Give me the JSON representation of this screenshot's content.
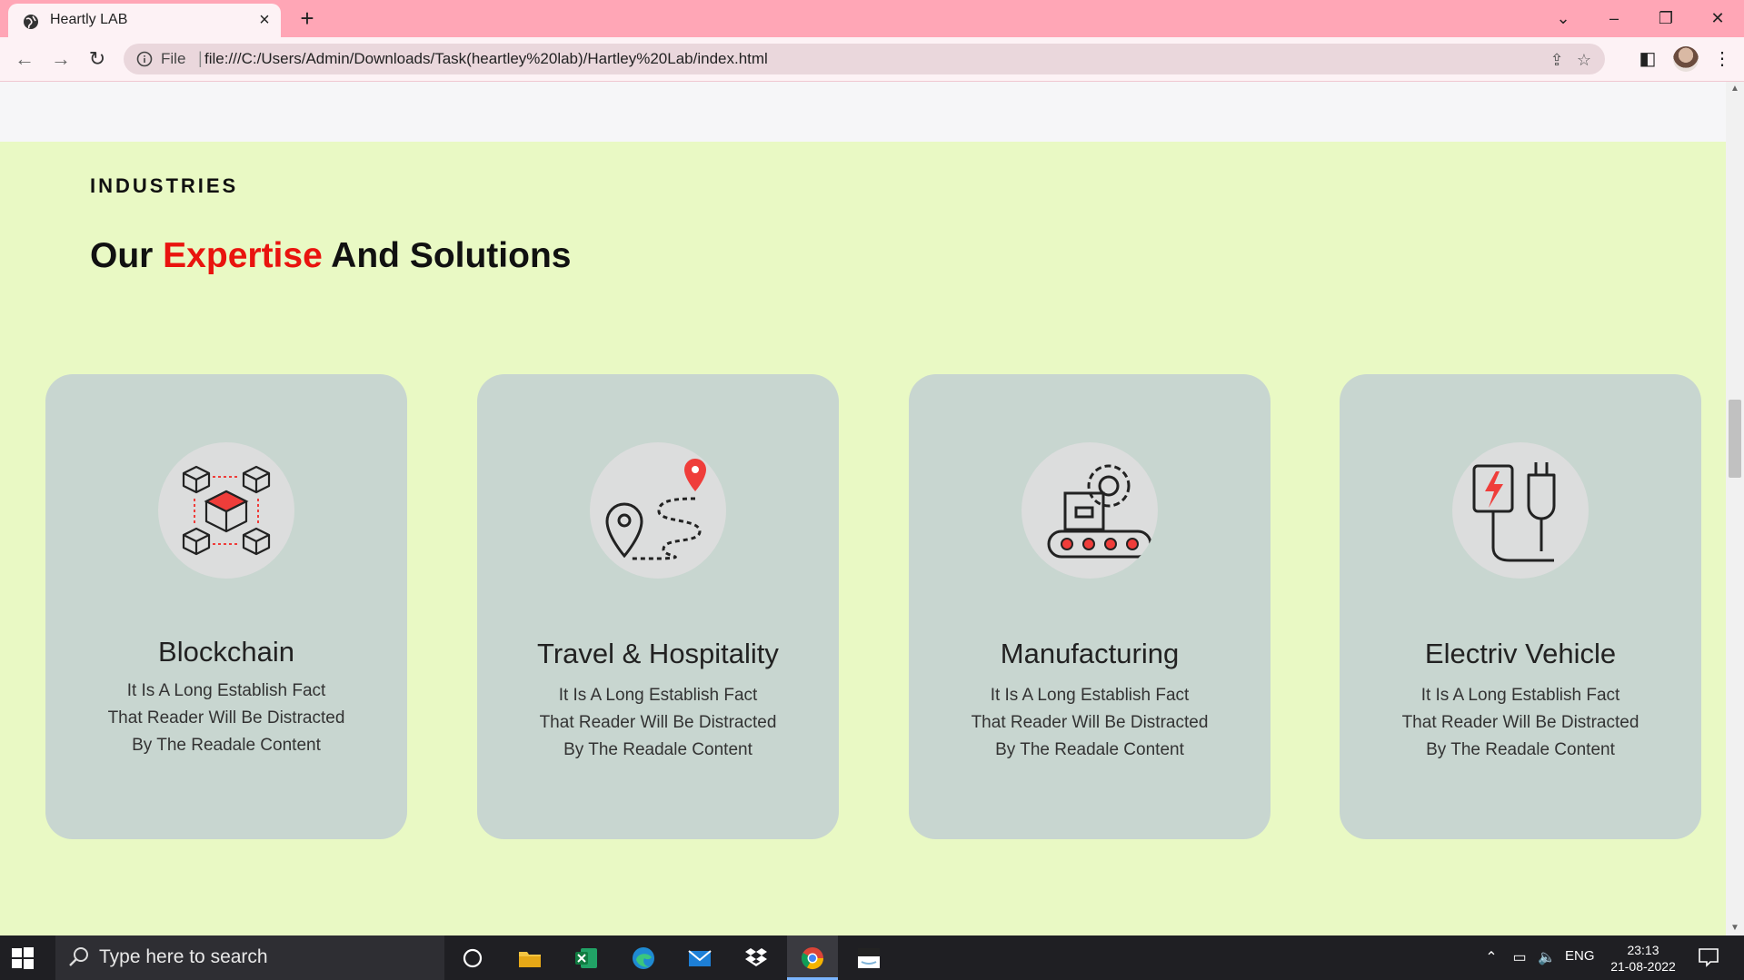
{
  "browser": {
    "tab_title": "Heartly LAB",
    "new_tab": "+",
    "address_prefix": "File",
    "address_separator": "|",
    "url": "file:///C:/Users/Admin/Downloads/Task(heartley%20lab)/Hartley%20Lab/index.html",
    "window_controls": {
      "dropdown": "⌄",
      "minimize": "–",
      "restore": "❐",
      "close": "✕"
    }
  },
  "section": {
    "eyebrow": "INDUSTRIES",
    "heading_pre": "Our ",
    "heading_accent": "Expertise",
    "heading_post": " And Solutions",
    "background": "#e9f9c4",
    "accent_color": "#e9140e"
  },
  "cards": [
    {
      "title": "Blockchain",
      "icon": "blockchain-icon",
      "desc": [
        "It Is A Long Establish Fact",
        "That Reader Will Be Distracted",
        "By The Readale Content"
      ]
    },
    {
      "title": "Travel & Hospitality",
      "icon": "travel-route-icon",
      "desc": [
        "It Is A Long Establish Fact",
        "That Reader Will Be Distracted",
        "By The Readale Content"
      ]
    },
    {
      "title": "Manufacturing",
      "icon": "manufacturing-conveyor-icon",
      "desc": [
        "It Is A Long Establish Fact",
        "That Reader Will Be Distracted",
        "By The Readale Content"
      ]
    },
    {
      "title": "Electriv Vehicle",
      "icon": "ev-charger-icon",
      "desc": [
        "It Is A Long Establish Fact",
        "That Reader Will Be Distracted",
        "By The Readale Content"
      ]
    }
  ],
  "taskbar": {
    "search_placeholder": "Type here to search",
    "language": "ENG",
    "time": "23:13",
    "date": "21-08-2022"
  }
}
